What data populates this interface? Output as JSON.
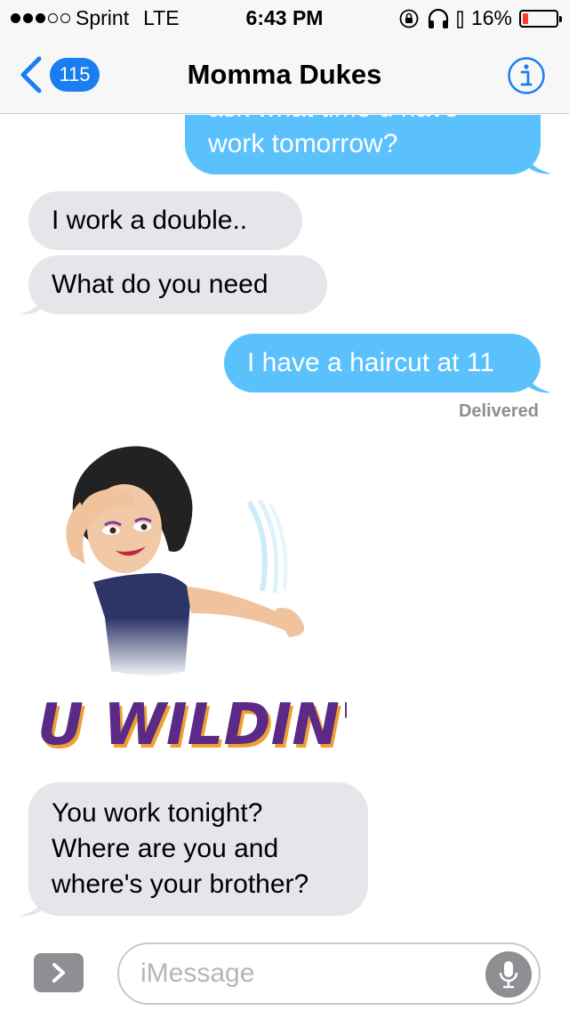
{
  "status_bar": {
    "carrier": "Sprint",
    "network": "LTE",
    "time": "6:43 PM",
    "battery_percent": "16%",
    "battery_level": 0.16,
    "icons": [
      "orientation-lock-icon",
      "headphones-icon",
      "battery-icon"
    ]
  },
  "nav": {
    "back_count": "115",
    "title": "Momma Dukes",
    "info_icon": "info-icon"
  },
  "messages": [
    {
      "direction": "outgoing",
      "text": "ask what time u have",
      "partially_hidden": true
    },
    {
      "direction": "outgoing",
      "text": "work tomorrow?"
    },
    {
      "direction": "incoming",
      "text": "I work a double.."
    },
    {
      "direction": "incoming",
      "text": "What do you need"
    },
    {
      "direction": "outgoing",
      "text": "I have a haircut at 11"
    },
    {
      "direction": "incoming",
      "type": "sticker",
      "text": "U WILDIN'"
    },
    {
      "direction": "incoming",
      "lines": [
        "You work tonight?",
        "Where are you and",
        "where's your brother?"
      ]
    }
  ],
  "delivered_label": "Delivered",
  "input": {
    "placeholder": "iMessage",
    "value": "",
    "apps_icon": "chevron-right-icon",
    "mic_icon": "microphone-icon"
  },
  "colors": {
    "outgoing_bubble": "#5ac1fc",
    "incoming_bubble": "#e5e5ea",
    "accent": "#1a7ef0",
    "battery_low": "#ff3b30",
    "sticker_text": "#5b2a86"
  }
}
